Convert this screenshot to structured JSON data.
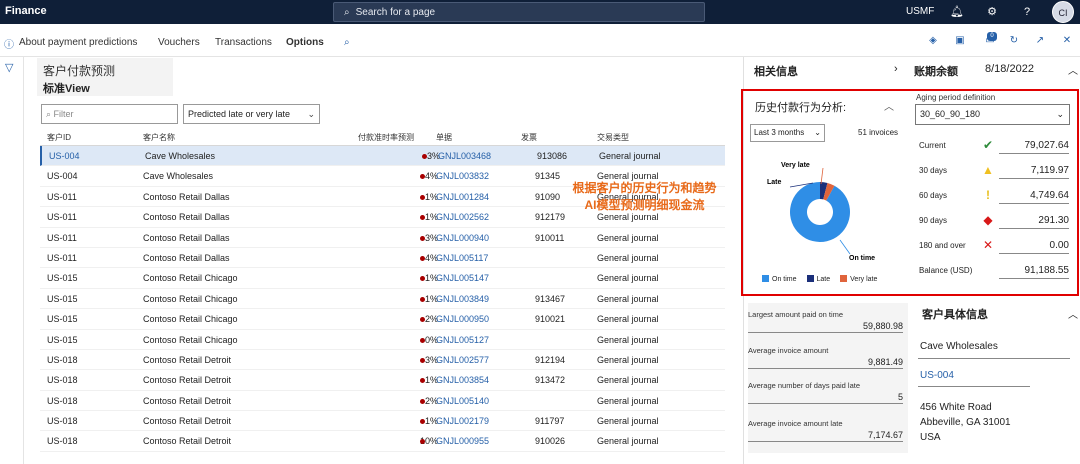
{
  "topbar": {
    "brand": "Finance",
    "search_placeholder": "Search for a page",
    "company": "USMF",
    "avatar": "CI"
  },
  "actions": [
    {
      "label": "About payment predictions"
    },
    {
      "label": "Vouchers"
    },
    {
      "label": "Transactions"
    },
    {
      "label": "Options"
    }
  ],
  "notification_count": "0",
  "title": {
    "line1": "客户付款预测",
    "line2": "标准View"
  },
  "filter_placeholder": "Filter",
  "view_select": "Predicted late or very late",
  "columns": [
    "客户ID",
    "客户名称",
    "付款准时率预测",
    "单据",
    "发票",
    "交易类型"
  ],
  "rows": [
    {
      "id": "US-004",
      "name": "Cave Wholesales",
      "pct": "3%",
      "voucher": "GNJL003468",
      "invoice": "913086",
      "type": "General journal"
    },
    {
      "id": "US-004",
      "name": "Cave Wholesales",
      "pct": "4%",
      "voucher": "GNJL003832",
      "invoice": "91345",
      "type": "General journal"
    },
    {
      "id": "US-011",
      "name": "Contoso Retail Dallas",
      "pct": "1%",
      "voucher": "GNJL001284",
      "invoice": "91090",
      "type": "General journal"
    },
    {
      "id": "US-011",
      "name": "Contoso Retail Dallas",
      "pct": "1%",
      "voucher": "GNJL002562",
      "invoice": "912179",
      "type": "General journal"
    },
    {
      "id": "US-011",
      "name": "Contoso Retail Dallas",
      "pct": "3%",
      "voucher": "GNJL000940",
      "invoice": "910011",
      "type": "General journal"
    },
    {
      "id": "US-011",
      "name": "Contoso Retail Dallas",
      "pct": "4%",
      "voucher": "GNJL005117",
      "invoice": "",
      "type": "General journal"
    },
    {
      "id": "US-015",
      "name": "Contoso Retail Chicago",
      "pct": "1%",
      "voucher": "GNJL005147",
      "invoice": "",
      "type": "General journal"
    },
    {
      "id": "US-015",
      "name": "Contoso Retail Chicago",
      "pct": "1%",
      "voucher": "GNJL003849",
      "invoice": "913467",
      "type": "General journal"
    },
    {
      "id": "US-015",
      "name": "Contoso Retail Chicago",
      "pct": "2%",
      "voucher": "GNJL000950",
      "invoice": "910021",
      "type": "General journal"
    },
    {
      "id": "US-015",
      "name": "Contoso Retail Chicago",
      "pct": "0%",
      "voucher": "GNJL005127",
      "invoice": "",
      "type": "General journal"
    },
    {
      "id": "US-018",
      "name": "Contoso Retail Detroit",
      "pct": "3%",
      "voucher": "GNJL002577",
      "invoice": "912194",
      "type": "General journal"
    },
    {
      "id": "US-018",
      "name": "Contoso Retail Detroit",
      "pct": "1%",
      "voucher": "GNJL003854",
      "invoice": "913472",
      "type": "General journal"
    },
    {
      "id": "US-018",
      "name": "Contoso Retail Detroit",
      "pct": "2%",
      "voucher": "GNJL005140",
      "invoice": "",
      "type": "General journal"
    },
    {
      "id": "US-018",
      "name": "Contoso Retail Detroit",
      "pct": "1%",
      "voucher": "GNJL002179",
      "invoice": "911797",
      "type": "General journal"
    },
    {
      "id": "US-018",
      "name": "Contoso Retail Detroit",
      "pct": "10%",
      "voucher": "GNJL000955",
      "invoice": "910026",
      "type": "General journal"
    }
  ],
  "related": {
    "title": "相关信息",
    "balance_title": "账期余额",
    "balance_date": "8/18/2022"
  },
  "history": {
    "title": "历史付款行为分析:",
    "range": "Last 3 months",
    "invoice_count": "51 invoices",
    "pie": [
      {
        "name": "On time",
        "value": 92,
        "color": "#2f8ee6"
      },
      {
        "name": "Late",
        "value": 4,
        "color": "#1b2f7a"
      },
      {
        "name": "Very late",
        "value": 4,
        "color": "#e0643c"
      }
    ],
    "label_very_late": "Very late",
    "label_late": "Late",
    "label_on_time": "On time"
  },
  "annotation": {
    "line1": "根据客户的历史行为和趋势",
    "line2": "AI模型预测明细现金流"
  },
  "aging": {
    "label": "Aging period definition",
    "value": "30_60_90_180",
    "rows": [
      {
        "label": "Current",
        "value": "79,027.64",
        "icon": "check-icon",
        "color": "#2e8b3a"
      },
      {
        "label": "30 days",
        "value": "7,119.97",
        "icon": "warning-icon",
        "color": "#f0c020"
      },
      {
        "label": "60 days",
        "value": "4,749.64",
        "icon": "exclamation-icon",
        "color": "#e8c020"
      },
      {
        "label": "90 days",
        "value": "291.30",
        "icon": "diamond-icon",
        "color": "#d81818"
      },
      {
        "label": "180 and over",
        "value": "0.00",
        "icon": "cross-icon",
        "color": "#d81818"
      }
    ],
    "balance_label": "Balance (USD)",
    "balance_value": "91,188.55"
  },
  "stats": [
    {
      "label": "Largest amount paid on time",
      "value": "59,880.98"
    },
    {
      "label": "Average invoice amount",
      "value": "9,881.49"
    },
    {
      "label": "Average number of days paid late",
      "value": "5"
    },
    {
      "label": "Average invoice amount late",
      "value": "7,174.67"
    }
  ],
  "customer": {
    "title": "客户具体信息",
    "name": "Cave Wholesales",
    "id": "US-004",
    "addr1": "456 White Road",
    "addr2": "Abbeville, GA 31001",
    "addr3": "USA"
  }
}
